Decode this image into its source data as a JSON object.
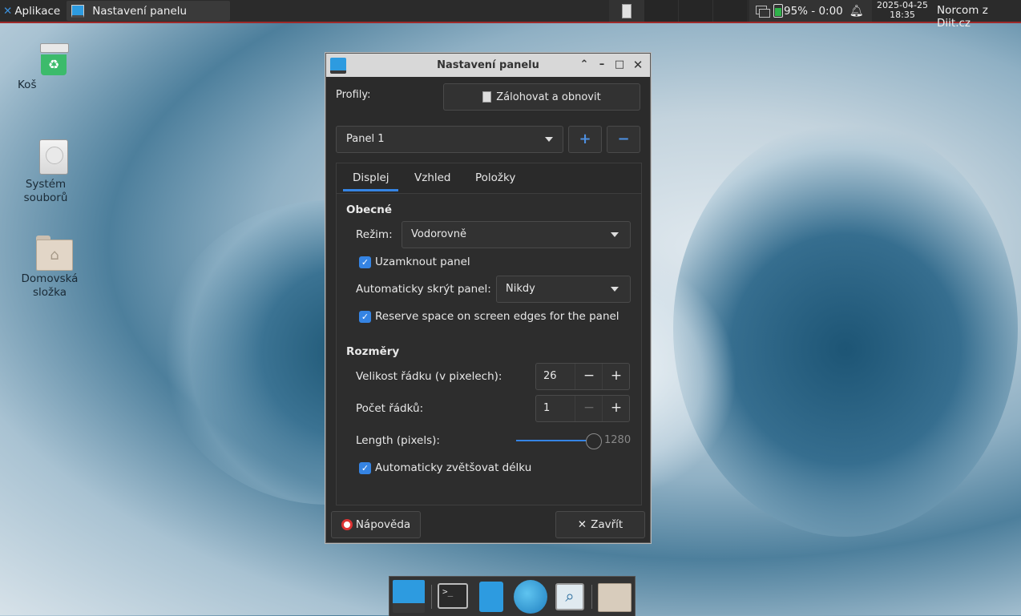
{
  "top_panel": {
    "apps_label": "Aplikace",
    "task_title": "Nastavení panelu",
    "battery": "95% - 0:00",
    "clock_date": "2025-04-25",
    "clock_time": "18:35",
    "user": "Norcom z Diit.cz"
  },
  "desktop": {
    "icons": [
      {
        "label": "Koš"
      },
      {
        "label": "Systém souborů"
      },
      {
        "label": "Domovská složka"
      }
    ]
  },
  "dialog": {
    "title": "Nastavení panelu",
    "profiles_label": "Profily:",
    "backup_button": "Zálohovat a obnovit",
    "panel_select": "Panel 1",
    "add_symbol": "+",
    "remove_symbol": "−",
    "tabs": [
      {
        "label": "Displej",
        "active": true
      },
      {
        "label": "Vzhled",
        "active": false
      },
      {
        "label": "Položky",
        "active": false
      }
    ],
    "general": {
      "heading": "Obecné",
      "mode_label": "Režim:",
      "mode_value": "Vodorovně",
      "lock_label": "Uzamknout panel",
      "lock_checked": true,
      "autohide_label": "Automaticky skrýt panel:",
      "autohide_value": "Nikdy",
      "reserve_label": "Reserve space on screen edges for the panel",
      "reserve_checked": true
    },
    "dimensions": {
      "heading": "Rozměry",
      "row_size_label": "Velikost řádku (v pixelech):",
      "row_size_value": "26",
      "rows_label": "Počet řádků:",
      "rows_value": "1",
      "length_label": "Length (pixels):",
      "length_value": "1280",
      "length_fraction": 0.95,
      "autogrow_label": "Automaticky zvětšovat délku",
      "autogrow_checked": true
    },
    "help_button": "Nápověda",
    "close_button": "Zavřít"
  },
  "colors": {
    "accent": "#3584e4",
    "panel_border": "#9e2a2a",
    "dialog_bg": "#2b2b2b"
  }
}
